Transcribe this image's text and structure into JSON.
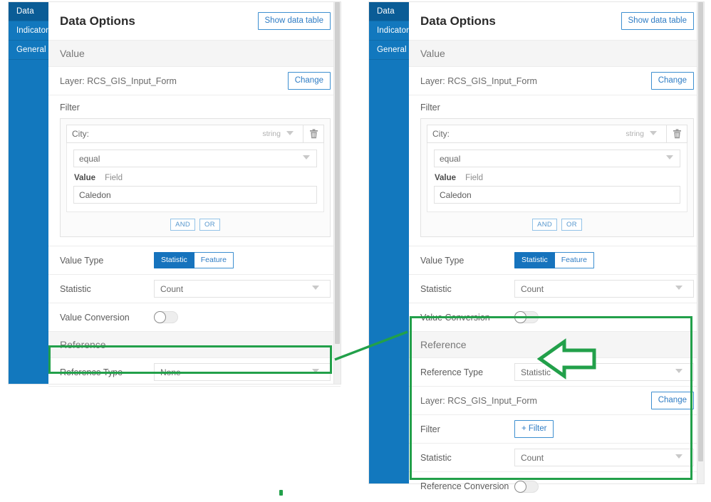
{
  "theme": {
    "rail_blue": "#1278be",
    "rail_active_blue": "#0a5c96",
    "accent_blue": "#1673bd",
    "link_blue": "#2e7cc4",
    "highlight_green": "#22a04a",
    "section_bg": "#f5f5f5"
  },
  "tabs": [
    {
      "label": "Data",
      "active": true
    },
    {
      "label": "Indicator",
      "active": false
    },
    {
      "label": "General",
      "active": false
    }
  ],
  "header": {
    "title": "Data Options",
    "show_data_table_label": "Show data table"
  },
  "value_section": {
    "heading": "Value",
    "layer_label": "Layer: RCS_GIS_Input_Form",
    "change_label": "Change",
    "filter": {
      "caption": "Filter",
      "field_label": "City:",
      "field_type": "string",
      "delete_icon": "trash-icon",
      "operator": "equal",
      "value_tab": "Value",
      "field_tab": "Field",
      "value": "Caledon",
      "and_label": "AND",
      "or_label": "OR"
    },
    "value_type": {
      "label": "Value Type",
      "options": [
        "Statistic",
        "Feature"
      ],
      "selected": "Statistic"
    },
    "statistic": {
      "label": "Statistic",
      "value": "Count"
    },
    "value_conversion": {
      "label": "Value Conversion",
      "state": "off"
    }
  },
  "reference_section": {
    "heading": "Reference",
    "left": {
      "reference_type_label": "Reference Type",
      "reference_type_value": "None"
    },
    "right": {
      "reference_type_label": "Reference Type",
      "reference_type_value": "Statistic",
      "layer_label": "Layer: RCS_GIS_Input_Form",
      "change_label": "Change",
      "filter_label": "Filter",
      "add_filter_label": "+ Filter",
      "statistic_label": "Statistic",
      "statistic_value": "Count",
      "reference_conversion_label": "Reference Conversion",
      "reference_conversion_state": "off"
    }
  },
  "annotations": {
    "left_highlight": "reference-type-row-highlight",
    "right_highlight": "reference-section-highlight",
    "connector": "connector-line",
    "callout_arrow": "left-pointing-arrow"
  }
}
